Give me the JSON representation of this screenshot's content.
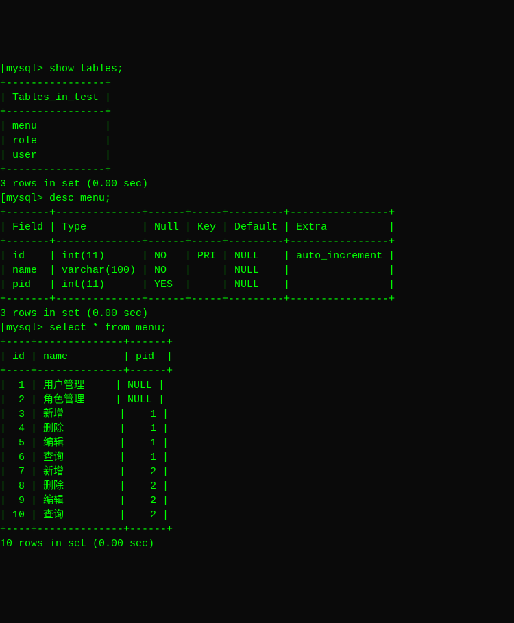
{
  "prompt_label": "[mysql>",
  "queries": {
    "q1": "show tables;",
    "q2": "desc menu;",
    "q3": "select * from menu;"
  },
  "tables_result": {
    "header": "Tables_in_test",
    "rows": [
      "menu",
      "role",
      "user"
    ],
    "summary": "3 rows in set (0.00 sec)"
  },
  "desc_result": {
    "headers": [
      "Field",
      "Type",
      "Null",
      "Key",
      "Default",
      "Extra"
    ],
    "rows": [
      {
        "field": "id",
        "type": "int(11)",
        "null": "NO",
        "key": "PRI",
        "default": "NULL",
        "extra": "auto_increment"
      },
      {
        "field": "name",
        "type": "varchar(100)",
        "null": "NO",
        "key": "",
        "default": "NULL",
        "extra": ""
      },
      {
        "field": "pid",
        "type": "int(11)",
        "null": "YES",
        "key": "",
        "default": "NULL",
        "extra": ""
      }
    ],
    "summary": "3 rows in set (0.00 sec)"
  },
  "select_result": {
    "headers": [
      "id",
      "name",
      "pid"
    ],
    "rows": [
      {
        "id": "1",
        "name": "用户管理",
        "pid": "NULL"
      },
      {
        "id": "2",
        "name": "角色管理",
        "pid": "NULL"
      },
      {
        "id": "3",
        "name": "新增",
        "pid": "1"
      },
      {
        "id": "4",
        "name": "删除",
        "pid": "1"
      },
      {
        "id": "5",
        "name": "编辑",
        "pid": "1"
      },
      {
        "id": "6",
        "name": "查询",
        "pid": "1"
      },
      {
        "id": "7",
        "name": "新增",
        "pid": "2"
      },
      {
        "id": "8",
        "name": "删除",
        "pid": "2"
      },
      {
        "id": "9",
        "name": "编辑",
        "pid": "2"
      },
      {
        "id": "10",
        "name": "查询",
        "pid": "2"
      }
    ],
    "summary": "10 rows in set (0.00 sec)"
  },
  "chart_data": {
    "type": "table",
    "tables": [
      {
        "title": "Tables_in_test",
        "columns": [
          "Tables_in_test"
        ],
        "rows": [
          [
            "menu"
          ],
          [
            "role"
          ],
          [
            "user"
          ]
        ]
      },
      {
        "title": "desc menu",
        "columns": [
          "Field",
          "Type",
          "Null",
          "Key",
          "Default",
          "Extra"
        ],
        "rows": [
          [
            "id",
            "int(11)",
            "NO",
            "PRI",
            "NULL",
            "auto_increment"
          ],
          [
            "name",
            "varchar(100)",
            "NO",
            "",
            "NULL",
            ""
          ],
          [
            "pid",
            "int(11)",
            "YES",
            "",
            "NULL",
            ""
          ]
        ]
      },
      {
        "title": "select * from menu",
        "columns": [
          "id",
          "name",
          "pid"
        ],
        "rows": [
          [
            1,
            "用户管理",
            null
          ],
          [
            2,
            "角色管理",
            null
          ],
          [
            3,
            "新增",
            1
          ],
          [
            4,
            "删除",
            1
          ],
          [
            5,
            "编辑",
            1
          ],
          [
            6,
            "查询",
            1
          ],
          [
            7,
            "新增",
            2
          ],
          [
            8,
            "删除",
            2
          ],
          [
            9,
            "编辑",
            2
          ],
          [
            10,
            "查询",
            2
          ]
        ]
      }
    ]
  }
}
